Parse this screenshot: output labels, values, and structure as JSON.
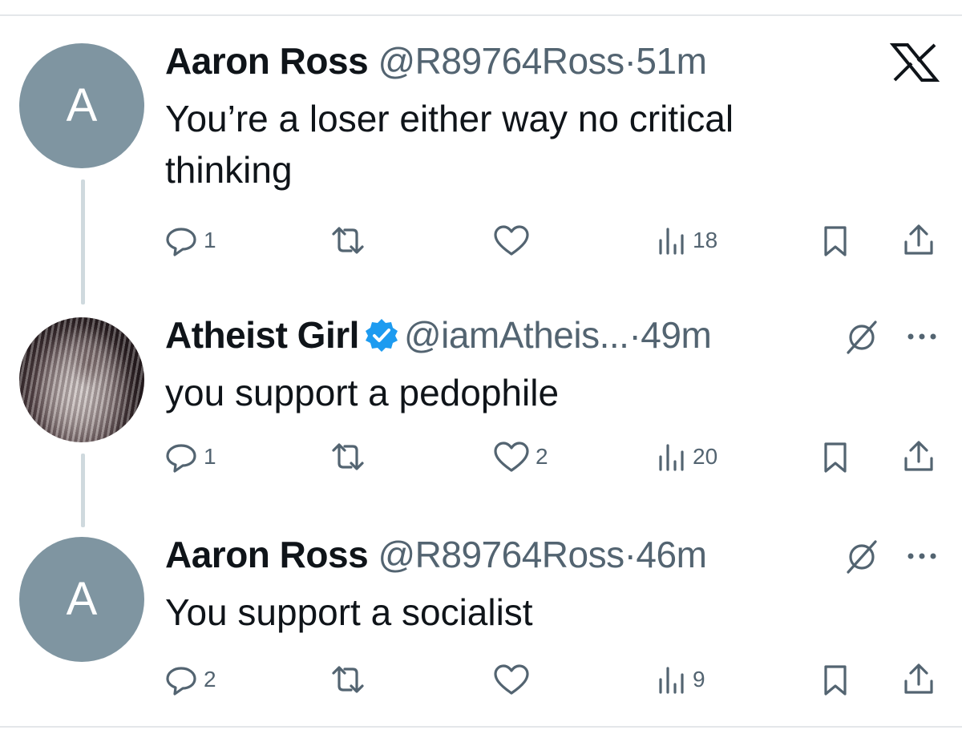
{
  "brand": {
    "logo_icon": "x-logo-icon"
  },
  "colors": {
    "avatar_bg": "#7f95a1",
    "muted": "#536471",
    "verified": "#1d9bf0",
    "text": "#0f1419"
  },
  "tweets": [
    {
      "avatar_letter": "A",
      "name": "Aaron Ross",
      "handle": "@R89764Ross",
      "dot": "·",
      "time": "51m",
      "text": "You’re a loser either way no critical thinking",
      "replies": "1",
      "retweets": "",
      "likes": "",
      "views": "18"
    },
    {
      "avatar_letter": "",
      "name": "Atheist Girl",
      "verified": true,
      "handle": "@iamAtheis...",
      "dot": "·",
      "time": "49m",
      "text": "you support a pedophile",
      "replies": "1",
      "retweets": "",
      "likes": "2",
      "views": "20"
    },
    {
      "avatar_letter": "A",
      "name": "Aaron Ross",
      "handle": "@R89764Ross",
      "dot": "·",
      "time": "46m",
      "text": "You support a socialist",
      "replies": "2",
      "retweets": "",
      "likes": "",
      "views": "9"
    }
  ]
}
